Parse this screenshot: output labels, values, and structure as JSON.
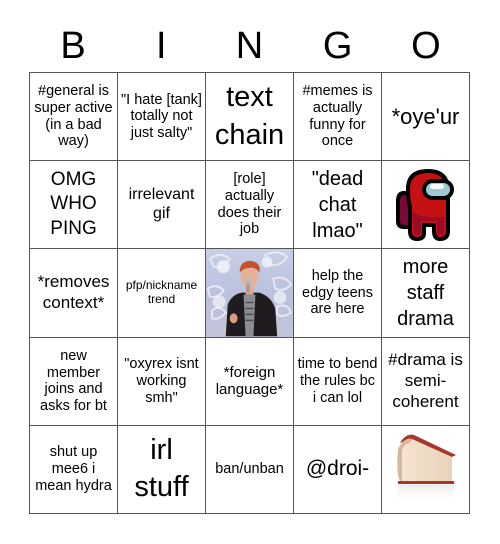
{
  "header": {
    "letters": [
      "B",
      "I",
      "N",
      "G",
      "O"
    ]
  },
  "board": {
    "cells": [
      {
        "text": "#general is super active (in a bad way)"
      },
      {
        "text": "\"I hate [tank] totally not just salty\""
      },
      {
        "text": "text chain"
      },
      {
        "text": "#memes is actually funny for once"
      },
      {
        "text": "*oye'ur"
      },
      {
        "text": "OMG WHO PING"
      },
      {
        "text": "irrelevant gif"
      },
      {
        "text": "[role] actually does their job"
      },
      {
        "text": "\"dead chat lmao\""
      },
      {
        "image": "among-us-red-crewmate"
      },
      {
        "text": "*removes context*"
      },
      {
        "text": "pfp/nickname trend"
      },
      {
        "image": "singer-with-microphone-photo",
        "free_space": true
      },
      {
        "text": "help the edgy teens are here"
      },
      {
        "text": "more staff drama"
      },
      {
        "text": "new member joins and asks for bt"
      },
      {
        "text": "\"oxyrex isnt working smh\""
      },
      {
        "text": "*foreign language*"
      },
      {
        "text": "time to bend the rules bc i can lol"
      },
      {
        "text": "#drama is semi-coherent"
      },
      {
        "text": "shut up mee6 i mean hydra"
      },
      {
        "text": "irl stuff"
      },
      {
        "text": "ban/unban"
      },
      {
        "text": "@droi-"
      },
      {
        "image": "thick-book"
      }
    ]
  },
  "colors": {
    "grid_line": "#555555",
    "crewmate_red": "#c51111",
    "crewmate_shadow": "#7a0838",
    "visor": "#9ecad6",
    "book_pages": "#f3e3cf",
    "book_cover": "#a8362a"
  }
}
